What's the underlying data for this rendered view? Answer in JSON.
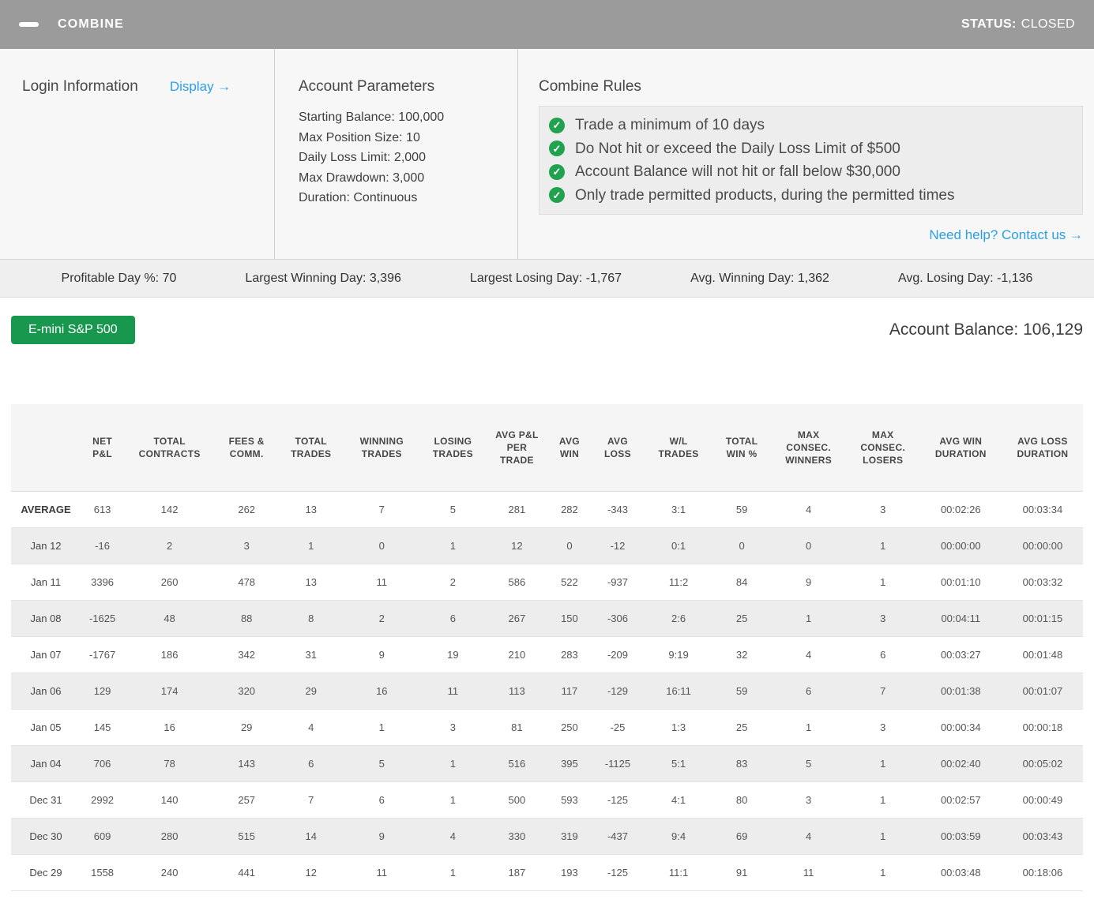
{
  "colors": {
    "titlebar_gray": "#9b9b9b",
    "accent_blue": "#2b9fe5",
    "brand_green": "#18984e",
    "check_green": "#22a14f"
  },
  "header": {
    "title": "COMBINE",
    "status_label": "STATUS:",
    "status_value": "CLOSED"
  },
  "login": {
    "title": "Login Information",
    "display_link": "Display →"
  },
  "account_parameters": {
    "title": "Account Parameters",
    "lines": [
      "Starting Balance: 100,000",
      "Max Position Size: 10",
      "Daily Loss Limit: 2,000",
      "Max Drawdown: 3,000",
      "Duration: Continuous"
    ]
  },
  "combine_rules": {
    "title": "Combine Rules",
    "rules": [
      "Trade a minimum of 10 days",
      "Do Not hit or exceed the Daily Loss Limit of $500",
      "Account Balance will not hit or fall below $30,000",
      "Only trade permitted products, during the permitted times"
    ],
    "help_link": "Need help? Contact us →"
  },
  "stats": [
    "Profitable Day %: 70",
    "Largest Winning Day: 3,396",
    "Largest Losing Day: -1,767",
    "Avg. Winning Day: 1,362",
    "Avg. Losing Day: -1,136"
  ],
  "instrument_button": "E-mini S&P 500",
  "account_balance": "Account Balance: 106,129",
  "table": {
    "columns": [
      "",
      "NET P&L",
      "TOTAL CONTRACTS",
      "FEES & COMM.",
      "TOTAL TRADES",
      "WINNING TRADES",
      "LOSING TRADES",
      "AVG P&L PER TRADE",
      "AVG WIN",
      "AVG LOSS",
      "W/L TRADES",
      "TOTAL WIN %",
      "MAX CONSEC. WINNERS",
      "MAX CONSEC. LOSERS",
      "AVG WIN DURATION",
      "AVG LOSS DURATION"
    ],
    "rows": [
      {
        "label": "AVERAGE",
        "bold": true,
        "values": [
          "613",
          "142",
          "262",
          "13",
          "7",
          "5",
          "281",
          "282",
          "-343",
          "3:1",
          "59",
          "4",
          "3",
          "00:02:26",
          "00:03:34"
        ]
      },
      {
        "label": "Jan 12",
        "bold": false,
        "values": [
          "-16",
          "2",
          "3",
          "1",
          "0",
          "1",
          "12",
          "0",
          "-12",
          "0:1",
          "0",
          "0",
          "1",
          "00:00:00",
          "00:00:00"
        ]
      },
      {
        "label": "Jan 11",
        "bold": false,
        "values": [
          "3396",
          "260",
          "478",
          "13",
          "11",
          "2",
          "586",
          "522",
          "-937",
          "11:2",
          "84",
          "9",
          "1",
          "00:01:10",
          "00:03:32"
        ]
      },
      {
        "label": "Jan 08",
        "bold": false,
        "values": [
          "-1625",
          "48",
          "88",
          "8",
          "2",
          "6",
          "267",
          "150",
          "-306",
          "2:6",
          "25",
          "1",
          "3",
          "00:04:11",
          "00:01:15"
        ]
      },
      {
        "label": "Jan 07",
        "bold": false,
        "values": [
          "-1767",
          "186",
          "342",
          "31",
          "9",
          "19",
          "210",
          "283",
          "-209",
          "9:19",
          "32",
          "4",
          "6",
          "00:03:27",
          "00:01:48"
        ]
      },
      {
        "label": "Jan 06",
        "bold": false,
        "values": [
          "129",
          "174",
          "320",
          "29",
          "16",
          "11",
          "113",
          "117",
          "-129",
          "16:11",
          "59",
          "6",
          "7",
          "00:01:38",
          "00:01:07"
        ]
      },
      {
        "label": "Jan 05",
        "bold": false,
        "values": [
          "145",
          "16",
          "29",
          "4",
          "1",
          "3",
          "81",
          "250",
          "-25",
          "1:3",
          "25",
          "1",
          "3",
          "00:00:34",
          "00:00:18"
        ]
      },
      {
        "label": "Jan 04",
        "bold": false,
        "values": [
          "706",
          "78",
          "143",
          "6",
          "5",
          "1",
          "516",
          "395",
          "-1125",
          "5:1",
          "83",
          "5",
          "1",
          "00:02:40",
          "00:05:02"
        ]
      },
      {
        "label": "Dec 31",
        "bold": false,
        "values": [
          "2992",
          "140",
          "257",
          "7",
          "6",
          "1",
          "500",
          "593",
          "-125",
          "4:1",
          "80",
          "3",
          "1",
          "00:02:57",
          "00:00:49"
        ]
      },
      {
        "label": "Dec 30",
        "bold": false,
        "values": [
          "609",
          "280",
          "515",
          "14",
          "9",
          "4",
          "330",
          "319",
          "-437",
          "9:4",
          "69",
          "4",
          "1",
          "00:03:59",
          "00:03:43"
        ]
      },
      {
        "label": "Dec 29",
        "bold": false,
        "values": [
          "1558",
          "240",
          "441",
          "12",
          "11",
          "1",
          "187",
          "193",
          "-125",
          "11:1",
          "91",
          "11",
          "1",
          "00:03:48",
          "00:18:06"
        ]
      }
    ]
  }
}
